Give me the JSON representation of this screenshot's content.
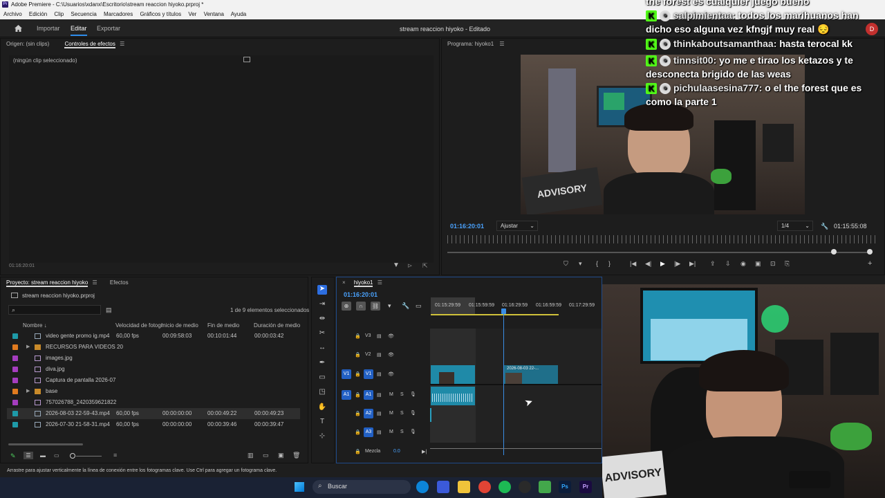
{
  "window": {
    "title": "Adobe Premiere - C:\\Usuarios\\xdanx\\Escritorio\\stream reaccion hiyoko.prproj *",
    "app_icon": "Pr"
  },
  "menu": [
    "Archivo",
    "Edición",
    "Clip",
    "Secuencia",
    "Marcadores",
    "Gráficos y títulos",
    "Ver",
    "Ventana",
    "Ayuda"
  ],
  "workspace": {
    "home": "home-icon",
    "tabs": [
      "Importar",
      "Editar",
      "Exportar"
    ],
    "active": "Editar",
    "project_title": "stream reaccion hiyoko - Editado"
  },
  "source_panel": {
    "tab_origin": "Origen: (sin clips)",
    "tab_effects": "Controles de efectos",
    "empty_text": "(ningún clip seleccionado)",
    "timecode": "01:16:20:01"
  },
  "program_monitor": {
    "tab": "Programa: hiyoko1",
    "timecode": "01:16:20:01",
    "fit": "Ajustar",
    "resolution": "1/4",
    "duration": "01:15:55:08"
  },
  "chat": {
    "partial_top": "the forest es cualquier juego bueno",
    "messages": [
      {
        "user": "salpimientaa:",
        "text": "todos los marihuanos han dicho eso alguna vez kfngjf muy real",
        "emoji": "😔"
      },
      {
        "user": "thinkaboutsamanthaa:",
        "text": "hasta terocal kk"
      },
      {
        "user": "tinnsit00:",
        "text": "yo me e tirao los ketazos y te desconecta brigido de las weas"
      },
      {
        "user": "pichulaasesina777:",
        "text": "o el the forest que es como la parte 1"
      }
    ],
    "avatar_letter": "D"
  },
  "project_panel": {
    "tab_project": "Proyecto: stream reaccion hiyoko",
    "tab_effects": "Efectos",
    "file": "stream reaccion hiyoko.prproj",
    "search_placeholder": "",
    "selection_count": "1 de 9 elementos seleccionados",
    "columns": [
      "Nombre",
      "Velocidad de fotogr",
      "Inicio de medio",
      "Fin de medio",
      "Duración de medio"
    ],
    "rows": [
      {
        "name": "video gente promo ig.mp4",
        "fps": "60,00 fps",
        "start": "00:09:58:03",
        "end": "00:10:01:44",
        "dur": "00:00:03:42",
        "color": "#1e9aa8",
        "kind": "clip",
        "folder": false
      },
      {
        "name": "RECURSOS PARA VIDEOS 20",
        "fps": "",
        "start": "",
        "end": "",
        "dur": "",
        "color": "#e07a1f",
        "kind": "folder",
        "folder": true
      },
      {
        "name": "images.jpg",
        "fps": "",
        "start": "",
        "end": "",
        "dur": "",
        "color": "#a53dbf",
        "kind": "image",
        "folder": false
      },
      {
        "name": "diva.jpg",
        "fps": "",
        "start": "",
        "end": "",
        "dur": "",
        "color": "#a53dbf",
        "kind": "image",
        "folder": false
      },
      {
        "name": "Captura de pantalla 2026-07",
        "fps": "",
        "start": "",
        "end": "",
        "dur": "",
        "color": "#a53dbf",
        "kind": "image",
        "folder": false
      },
      {
        "name": "base",
        "fps": "",
        "start": "",
        "end": "",
        "dur": "",
        "color": "#e07a1f",
        "kind": "folder",
        "folder": true
      },
      {
        "name": "757026788_2420359621822",
        "fps": "",
        "start": "",
        "end": "",
        "dur": "",
        "color": "#a53dbf",
        "kind": "image",
        "folder": false
      },
      {
        "name": "2026-08-03 22-59-43.mp4",
        "fps": "60,00 fps",
        "start": "00:00:00:00",
        "end": "00:00:49:22",
        "dur": "00:00:49:23",
        "color": "#1e9aa8",
        "kind": "clip",
        "folder": false,
        "selected": true
      },
      {
        "name": "2026-07-30 21-58-31.mp4",
        "fps": "60,00 fps",
        "start": "00:00:00:00",
        "end": "00:00:39:46",
        "dur": "00:00:39:47",
        "color": "#1e9aa8",
        "kind": "clip",
        "folder": false
      }
    ]
  },
  "timeline": {
    "tab": "hiyoko1",
    "timecode": "01:16:20:01",
    "ruler": [
      "01:15:29:59",
      "01:15:59:59",
      "01:16:29:59",
      "01:16:59:59",
      "01:17:29:59"
    ],
    "tracks": {
      "video": [
        "V3",
        "V2",
        "V1"
      ],
      "audio": [
        "A1",
        "A2",
        "A3"
      ],
      "src_v": "V1",
      "src_a": "A1",
      "mix": "Mezcla",
      "mix_val": "0.0"
    },
    "clip_label": "2026-08-03 22-...",
    "m": "M",
    "s": "S"
  },
  "status_bar": "Arrastre para ajustar verticalmente la línea de conexión entre los fotogramas clave. Use Ctrl para agregar un fotograma clave.",
  "taskbar": {
    "search": "Buscar"
  },
  "stream_overlay": {
    "poster_text": "ADVISORY",
    "shirt_text": "ADVISORY"
  }
}
